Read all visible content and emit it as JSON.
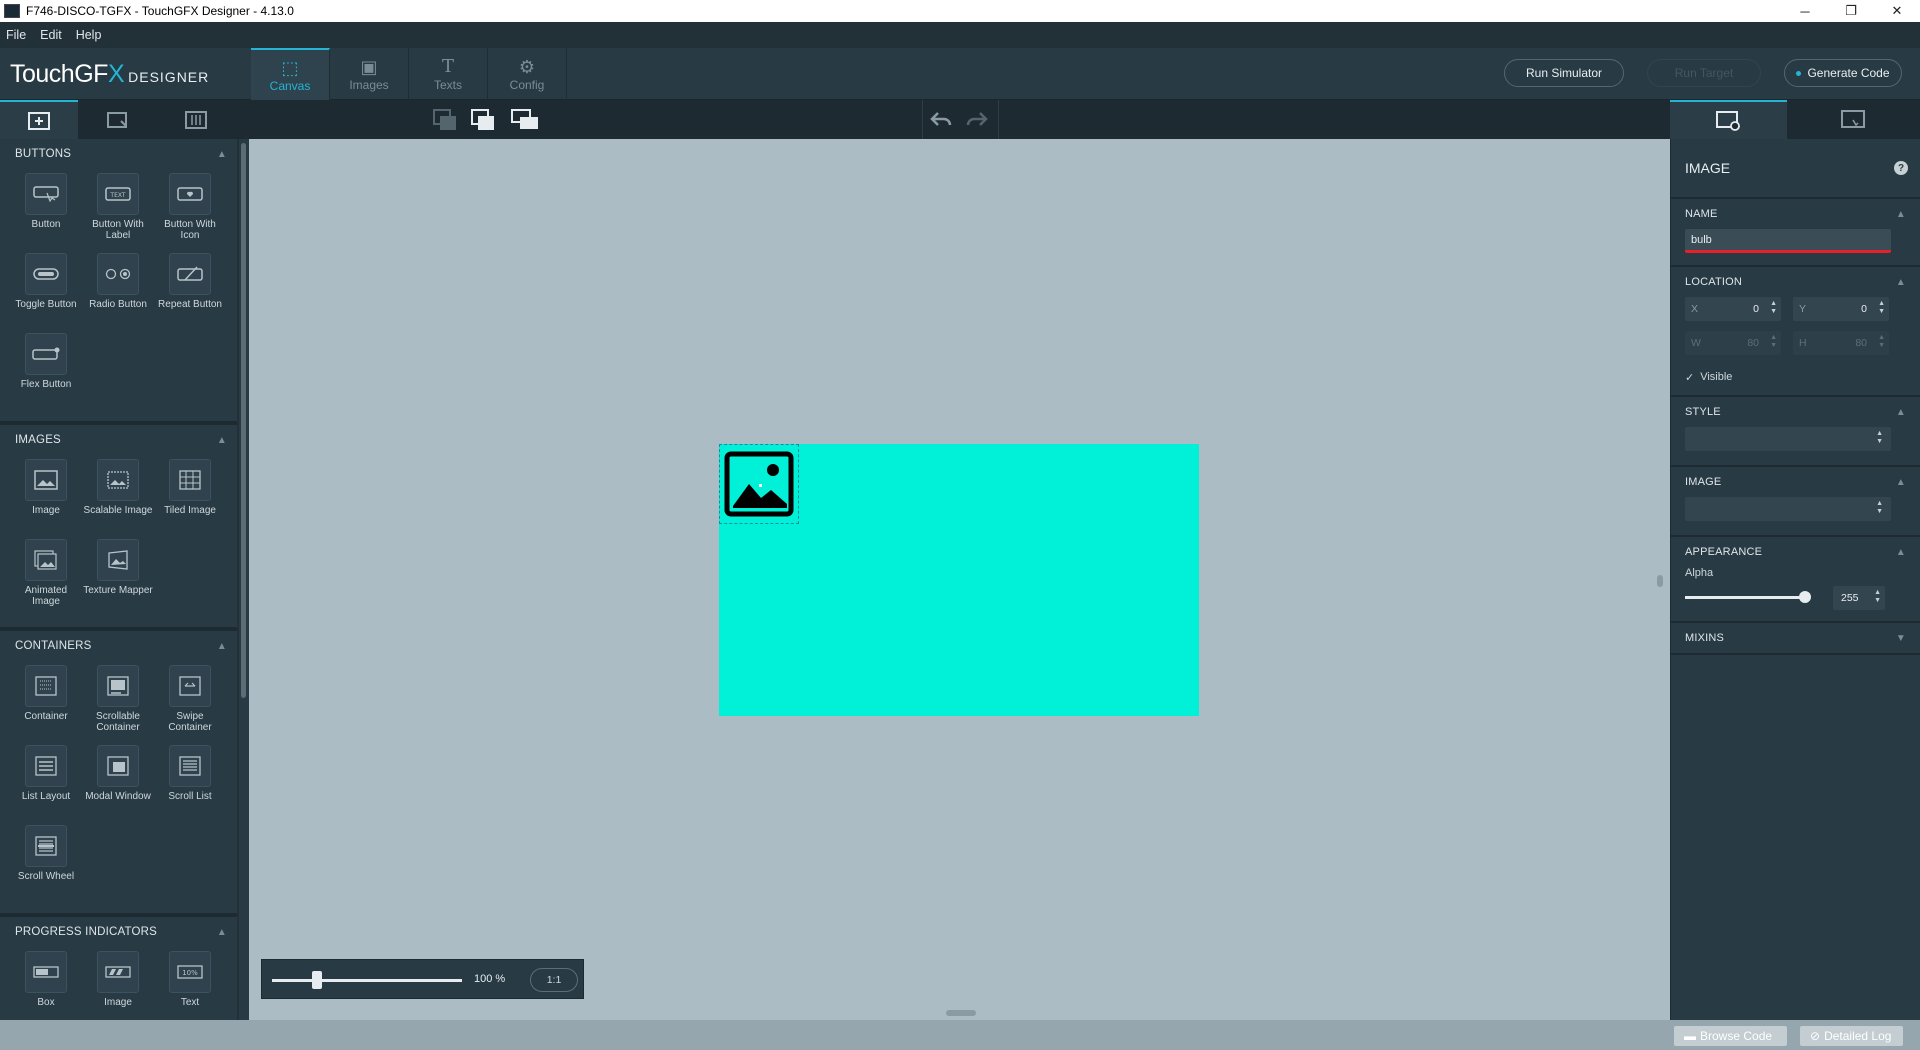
{
  "window": {
    "title": "F746-DISCO-TGFX - TouchGFX Designer - 4.13.0",
    "minimize": "─",
    "maximize": "❐",
    "close": "✕"
  },
  "menu": [
    "File",
    "Edit",
    "Help"
  ],
  "logo": {
    "main": "TouchGF",
    "accent": "X",
    "sub": "DESIGNER"
  },
  "nav_tabs": [
    {
      "label": "Canvas",
      "icon": "canvas-icon",
      "glyph": "⬚"
    },
    {
      "label": "Images",
      "icon": "images-icon",
      "glyph": "▣"
    },
    {
      "label": "Texts",
      "icon": "texts-icon",
      "glyph": "T"
    },
    {
      "label": "Config",
      "icon": "config-icon",
      "glyph": "⚙"
    }
  ],
  "header_buttons": {
    "run_simulator": "Run Simulator",
    "run_target": "Run Target",
    "generate_code": "Generate Code"
  },
  "left_panel": {
    "sections": [
      {
        "title": "BUTTONS",
        "widgets": [
          "Button",
          "Button With Label",
          "Button With Icon",
          "Toggle Button",
          "Radio Button",
          "Repeat Button",
          "Flex Button"
        ]
      },
      {
        "title": "IMAGES",
        "widgets": [
          "Image",
          "Scalable Image",
          "Tiled Image",
          "Animated Image",
          "Texture Mapper"
        ]
      },
      {
        "title": "CONTAINERS",
        "widgets": [
          "Container",
          "Scrollable Container",
          "Swipe Container",
          "List Layout",
          "Modal Window",
          "Scroll List",
          "Scroll Wheel"
        ]
      },
      {
        "title": "PROGRESS INDICATORS",
        "widgets": [
          "Box",
          "Image",
          "Text"
        ]
      }
    ]
  },
  "canvas": {
    "screen_color": "#00f0d8",
    "zoom": {
      "value": "100 %",
      "one_to_one": "1:1",
      "level_percent": 100
    }
  },
  "properties": {
    "title": "IMAGE",
    "help": "?",
    "name_section": "NAME",
    "name_value": "bulb",
    "location_section": "LOCATION",
    "x_label": "X",
    "x_value": "0",
    "y_label": "Y",
    "y_value": "0",
    "w_label": "W",
    "w_value": "80",
    "h_label": "H",
    "h_value": "80",
    "visible_label": "Visible",
    "style_section": "STYLE",
    "image_section": "IMAGE",
    "appearance_section": "APPEARANCE",
    "alpha_label": "Alpha",
    "alpha_value": "255",
    "mixins_section": "MIXINS"
  },
  "status_bar": {
    "browse_code": "Browse Code",
    "detailed_log": "Detailed Log"
  },
  "colors": {
    "accent": "#23b5d3",
    "panel": "#283a44",
    "canvas_bg": "#acbcc4",
    "error_underline": "#e8202a"
  }
}
